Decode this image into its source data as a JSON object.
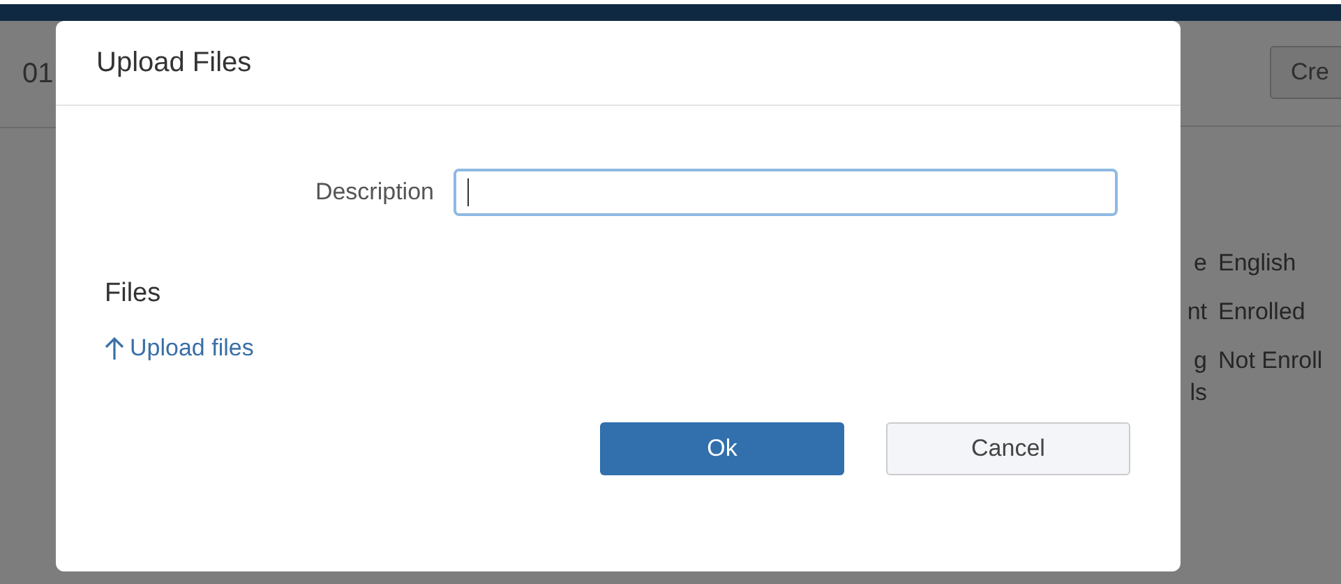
{
  "background_page": {
    "heading": "01",
    "create_button": "Cre",
    "details": [
      {
        "label": "e",
        "value": "English"
      },
      {
        "label": "nt",
        "value": "Enrolled"
      },
      {
        "label": "g\nls",
        "value": "Not Enroll"
      }
    ]
  },
  "dialog": {
    "title": "Upload Files",
    "description_field": {
      "label": "Description",
      "focused": true
    },
    "files_heading": "Files",
    "upload_link": "Upload files",
    "buttons": [
      {
        "label": "Ok",
        "kind": "primary"
      },
      {
        "label": "Cancel",
        "kind": "secondary"
      }
    ]
  }
}
